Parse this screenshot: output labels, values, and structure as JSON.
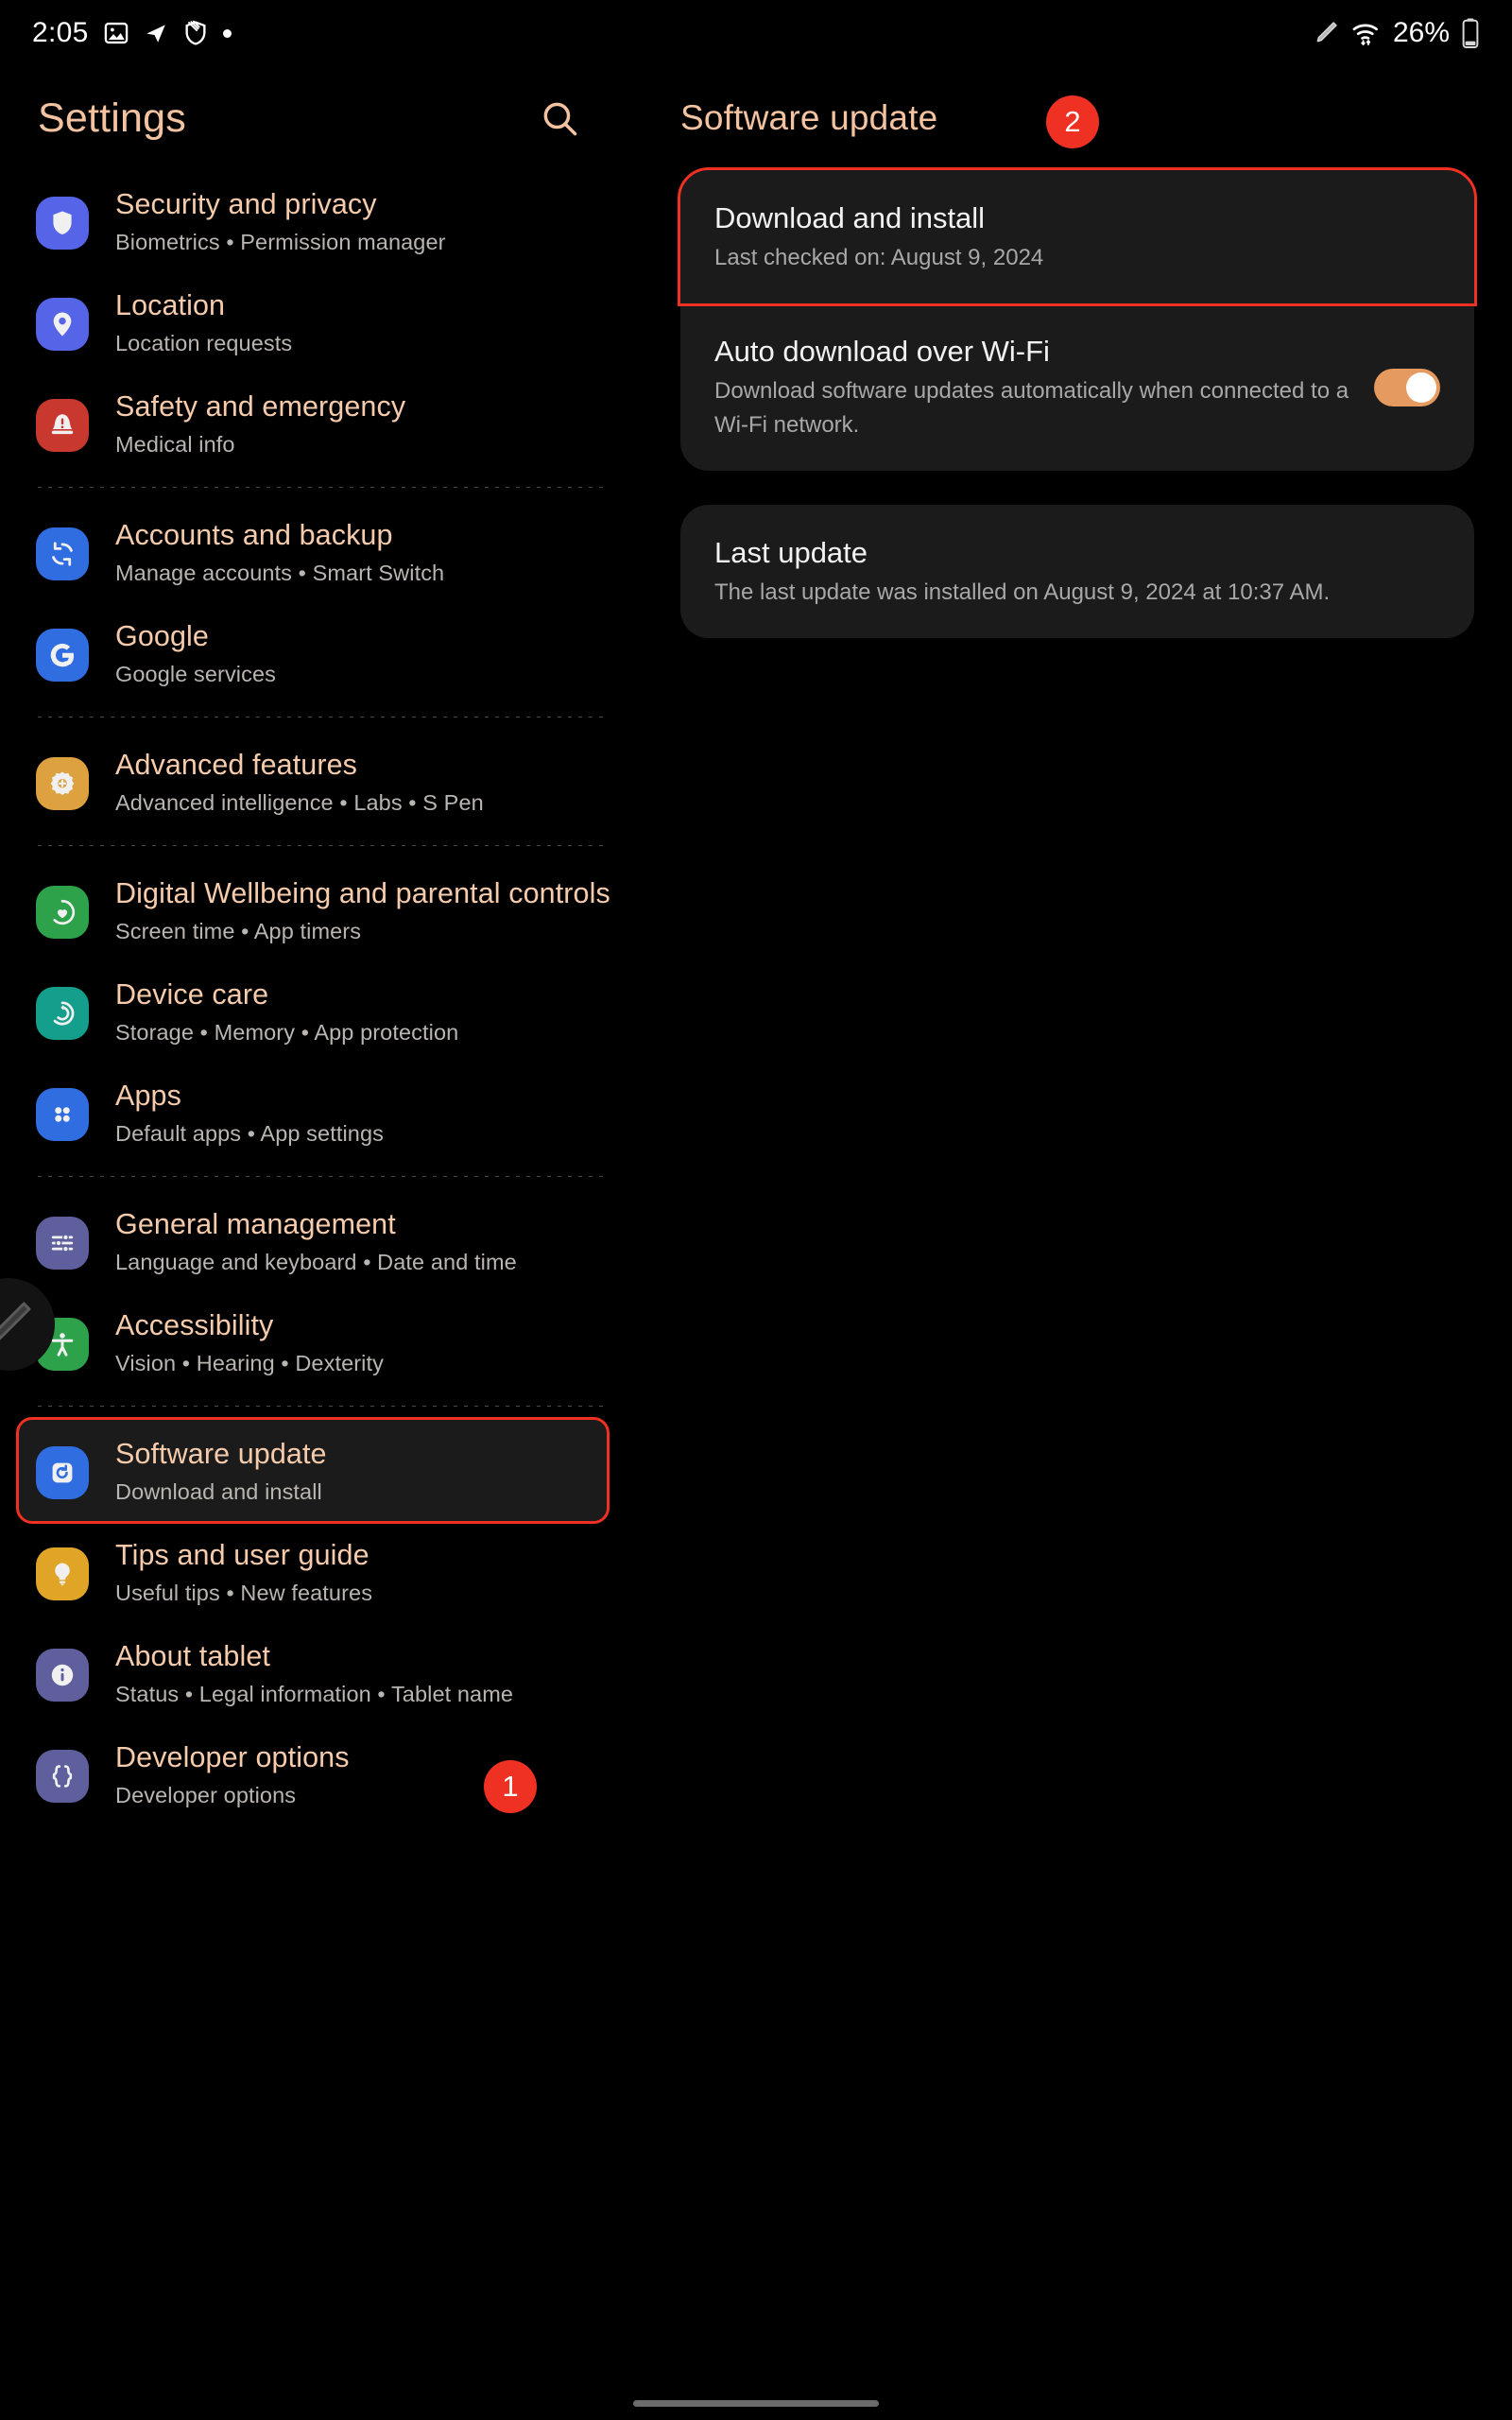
{
  "status_bar": {
    "time": "2:05",
    "battery_percent": "26%",
    "icons": [
      "image-icon",
      "navigation-arrow-icon",
      "shield-muted-icon",
      "dot-icon",
      "spen-icon",
      "wifi-icon",
      "battery-icon"
    ]
  },
  "sidebar": {
    "title": "Settings",
    "search_icon": "search-icon",
    "items": [
      {
        "label": "Security and privacy",
        "sub": "Biometrics  •  Permission manager",
        "icon": "shield-icon",
        "color": "#5665e8",
        "divider_after": false
      },
      {
        "label": "Location",
        "sub": "Location requests",
        "icon": "location-pin-icon",
        "color": "#5665e8",
        "divider_after": false
      },
      {
        "label": "Safety and emergency",
        "sub": "Medical info",
        "icon": "emergency-siren-icon",
        "color": "#c9382e",
        "divider_after": true
      },
      {
        "label": "Accounts and backup",
        "sub": "Manage accounts  •  Smart Switch",
        "icon": "sync-icon",
        "color": "#2f6de0",
        "divider_after": false
      },
      {
        "label": "Google",
        "sub": "Google services",
        "icon": "google-g-icon",
        "color": "#2f6de0",
        "divider_after": true
      },
      {
        "label": "Advanced features",
        "sub": "Advanced intelligence  •  Labs  •  S Pen",
        "icon": "gear-plus-icon",
        "color": "#dda13f",
        "divider_after": true
      },
      {
        "label": "Digital Wellbeing and parental controls",
        "sub": "Screen time  •  App timers",
        "icon": "wellbeing-heart-icon",
        "color": "#2ea14b",
        "divider_after": false
      },
      {
        "label": "Device care",
        "sub": "Storage  •  Memory  •  App protection",
        "icon": "device-care-icon",
        "color": "#149e8c",
        "divider_after": false
      },
      {
        "label": "Apps",
        "sub": "Default apps  •  App settings",
        "icon": "apps-grid-icon",
        "color": "#2f6de0",
        "divider_after": true
      },
      {
        "label": "General management",
        "sub": "Language and keyboard  •  Date and time",
        "icon": "sliders-icon",
        "color": "#5f5f9e",
        "divider_after": false
      },
      {
        "label": "Accessibility",
        "sub": "Vision  •  Hearing  •  Dexterity",
        "icon": "accessibility-icon",
        "color": "#2ea14b",
        "divider_after": true
      },
      {
        "label": "Software update",
        "sub": "Download and install",
        "icon": "software-update-icon",
        "color": "#2f6de0",
        "divider_after": false,
        "selected": true
      },
      {
        "label": "Tips and user guide",
        "sub": "Useful tips  •  New features",
        "icon": "lightbulb-icon",
        "color": "#e0a526",
        "divider_after": false
      },
      {
        "label": "About tablet",
        "sub": "Status  •  Legal information  •  Tablet name",
        "icon": "info-icon",
        "color": "#5f5f9e",
        "divider_after": false
      },
      {
        "label": "Developer options",
        "sub": "Developer options",
        "icon": "braces-icon",
        "color": "#5f5f9e",
        "divider_after": false
      }
    ]
  },
  "detail": {
    "title": "Software update",
    "rows": [
      {
        "title": "Download and install",
        "sub": "Last checked on: August 9, 2024",
        "highlighted": true
      },
      {
        "title": "Auto download over Wi-Fi",
        "sub": "Download software updates automatically when connected to a Wi-Fi network.",
        "toggle": true,
        "toggle_on": true
      }
    ],
    "last_update": {
      "title": "Last update",
      "sub": "The last update was installed on August 9, 2024 at 10:37 AM."
    }
  },
  "annotations": {
    "badge1": "1",
    "badge2": "2"
  },
  "colors": {
    "accent_text": "#f3c3a1",
    "badge_red": "#ef3124",
    "highlight_border": "#ef3124",
    "toggle_on": "#e59a5f",
    "card_bg": "#1b1b1b"
  }
}
